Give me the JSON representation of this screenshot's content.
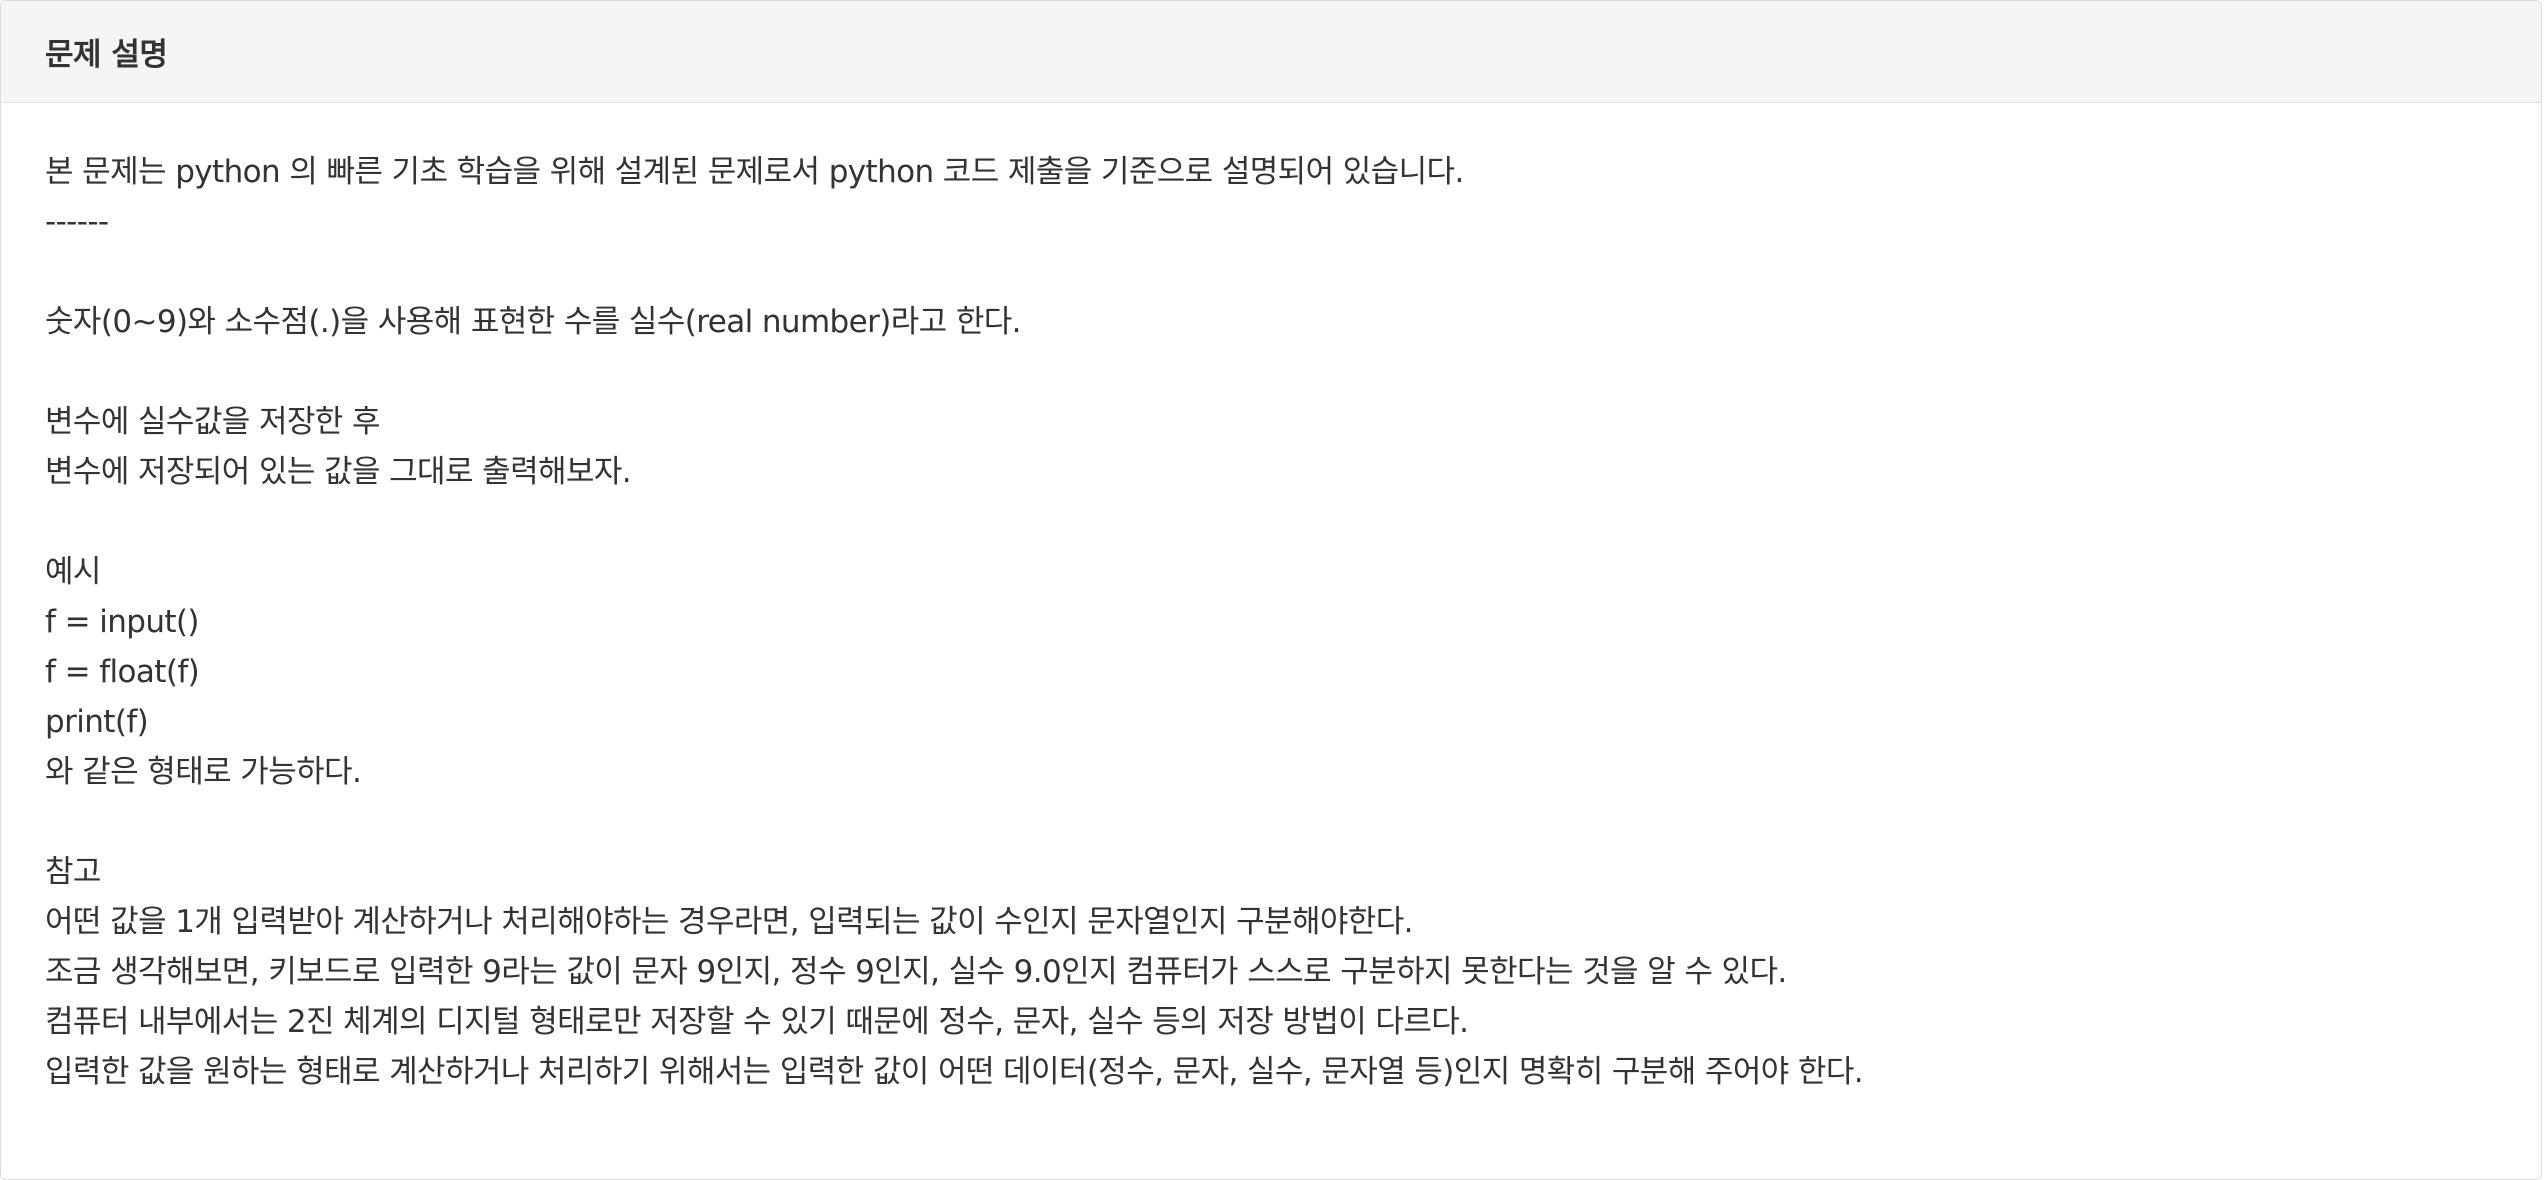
{
  "panel": {
    "title": "문제 설명"
  },
  "content": {
    "intro": "본 문제는 python 의 빠른 기초 학습을 위해 설계된 문제로서 python 코드 제출을 기준으로 설명되어 있습니다.",
    "separator": "------",
    "definition": "숫자(0~9)와 소수점(.)을 사용해 표현한 수를 실수(real number)라고 한다.",
    "task_line1": "변수에 실수값을 저장한 후",
    "task_line2": "변수에 저장되어 있는 값을 그대로 출력해보자.",
    "example_heading": "예시",
    "code_line1": "f = input()",
    "code_line2": "f = float(f)",
    "code_line3": "print(f)",
    "example_footer": "와 같은 형태로 가능하다.",
    "note_heading": "참고",
    "note_line1": "어떤 값을 1개 입력받아 계산하거나 처리해야하는 경우라면, 입력되는 값이 수인지 문자열인지 구분해야한다.",
    "note_line2": "조금 생각해보면, 키보드로 입력한 9라는 값이 문자 9인지, 정수 9인지, 실수 9.0인지 컴퓨터가 스스로 구분하지 못한다는 것을 알 수 있다.",
    "note_line3": "컴퓨터 내부에서는 2진 체계의 디지털 형태로만 저장할 수 있기 때문에 정수, 문자, 실수 등의 저장 방법이 다르다.",
    "note_line4": "입력한 값을 원하는 형태로 계산하거나 처리하기 위해서는 입력한 값이 어떤 데이터(정수, 문자, 실수, 문자열 등)인지 명확히 구분해 주어야 한다."
  }
}
